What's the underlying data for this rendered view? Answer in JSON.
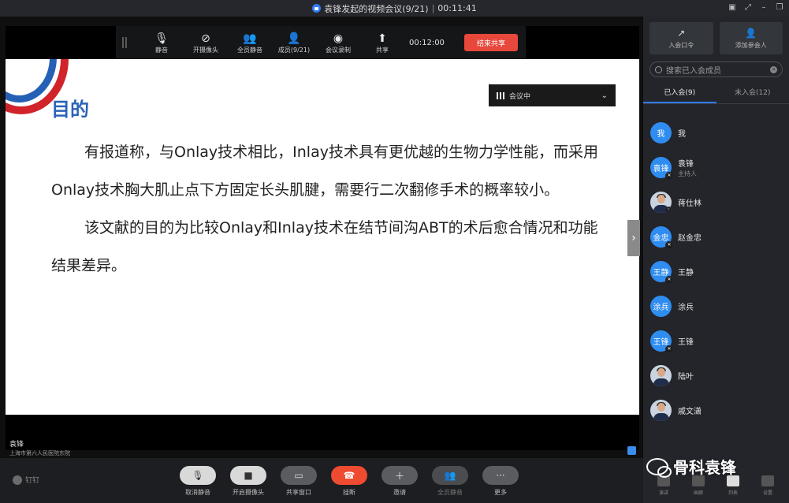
{
  "window": {
    "title": "袁锋发起的视频会议(9/21)",
    "elapsed": "00:11:41"
  },
  "share_bar": {
    "mute": "静音",
    "camera": "开摄像头",
    "mute_all": "全员静音",
    "members": "成员(9/21)",
    "record": "会议录制",
    "share": "共享",
    "timer": "00:12:00",
    "end_share": "结束共享"
  },
  "slide": {
    "title": "目的",
    "para1": "有报道称，与Onlay技术相比，Inlay技术具有更优越的生物力学性能，而采用Onlay技术胸大肌止点下方固定长头肌腱，需要行二次翻修手术的概率较小。",
    "para2": "该文献的目的为比较Onlay和Inlay技术在结节间沟ABT的术后愈合情况和功能结果差异。"
  },
  "meeting_pill": {
    "label": "会议中"
  },
  "speaker": {
    "name": "袁锋",
    "org": "上海市第六人民医院东院"
  },
  "toolbar": {
    "brand": "钉钉",
    "unmute": "取消静音",
    "camera_on": "开启摄像头",
    "share_window": "共享窗口",
    "hangup": "挂断",
    "invite": "邀请",
    "mute_all": "全员静音",
    "more": "更多",
    "more_icon_text": "···"
  },
  "sidebar": {
    "join_code": "入会口令",
    "add_participant": "添加参会人",
    "search_placeholder": "搜索已入会成员",
    "tab_joined": "已入会(9)",
    "tab_not_joined": "未入会(12)",
    "members": [
      {
        "name": "我",
        "avatar": "我",
        "role": ""
      },
      {
        "name": "袁锋",
        "avatar": "袁锋",
        "role": "主持人"
      },
      {
        "name": "蒋仕林",
        "avatar": "",
        "role": ""
      },
      {
        "name": "赵金忠",
        "avatar": "金忠",
        "role": ""
      },
      {
        "name": "王静",
        "avatar": "王静",
        "role": ""
      },
      {
        "name": "涂兵",
        "avatar": "涂兵",
        "role": ""
      },
      {
        "name": "王锋",
        "avatar": "王锋",
        "role": ""
      },
      {
        "name": "陆叶",
        "avatar": "",
        "role": ""
      },
      {
        "name": "戚文潇",
        "avatar": "",
        "role": ""
      }
    ],
    "bottom": {
      "speaker_view": "演讲",
      "gallery": "画廊",
      "list": "列表",
      "settings": "设置"
    }
  },
  "watermark": {
    "text": "骨科袁锋"
  }
}
